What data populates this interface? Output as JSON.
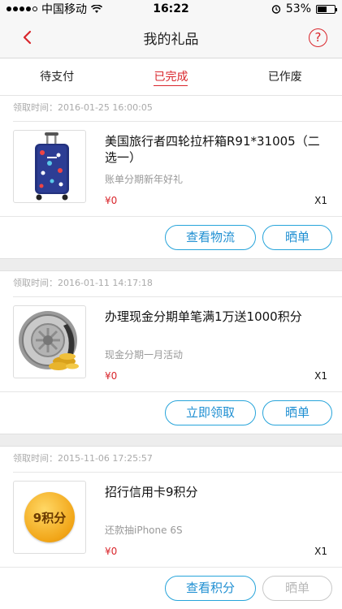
{
  "status_bar": {
    "carrier": "中国移动",
    "time": "16:22",
    "battery": "53%",
    "battery_level": 0.53
  },
  "nav": {
    "title": "我的礼品",
    "help_label": "?"
  },
  "tabs": [
    {
      "label": "待支付",
      "active": false
    },
    {
      "label": "已完成",
      "active": true
    },
    {
      "label": "已作废",
      "active": false
    }
  ],
  "orders": [
    {
      "time_label": "领取时间：",
      "time": "2016-01-25 16:00:05",
      "name": "美国旅行者四轮拉杆箱R91*31005（二选一）",
      "sub": "账单分期新年好礼",
      "price": "¥0",
      "qty": "X1",
      "actions": [
        {
          "label": "查看物流",
          "enabled": true
        },
        {
          "label": "晒单",
          "enabled": true
        }
      ]
    },
    {
      "time_label": "领取时间：",
      "time": "2016-01-11 14:17:18",
      "name": "办理现金分期单笔满1万送1000积分",
      "sub": "现金分期一月活动",
      "price": "¥0",
      "qty": "X1",
      "actions": [
        {
          "label": "立即领取",
          "enabled": true
        },
        {
          "label": "晒单",
          "enabled": true
        }
      ]
    },
    {
      "time_label": "领取时间：",
      "time": "2015-11-06 17:25:57",
      "name": "招行信用卡9积分",
      "sub": "还款抽iPhone 6S",
      "price": "¥0",
      "qty": "X1",
      "thumb_text": "9积分",
      "actions": [
        {
          "label": "查看积分",
          "enabled": true
        },
        {
          "label": "晒单",
          "enabled": false
        }
      ]
    }
  ]
}
